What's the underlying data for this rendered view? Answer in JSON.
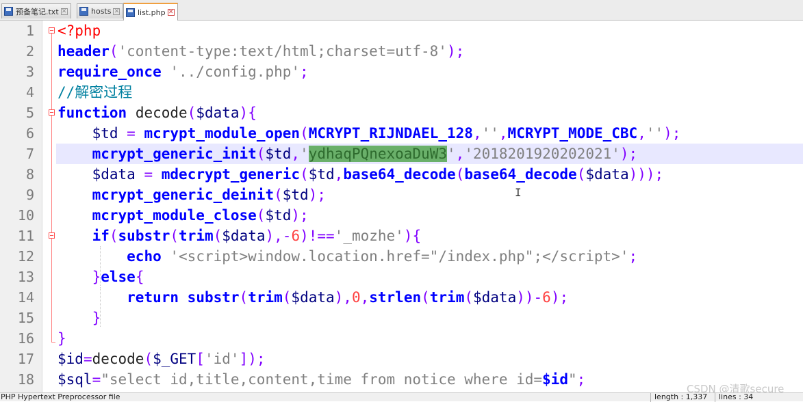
{
  "tabs": [
    {
      "label": "预备笔记.txt",
      "active": false
    },
    {
      "label": "hosts",
      "active": false
    },
    {
      "label": "list.php",
      "active": true
    }
  ],
  "editor": {
    "current_line": 7,
    "lines": [
      {
        "n": "1",
        "html": "<span class=\"tag\">&lt;?php</span>"
      },
      {
        "n": "2",
        "html": "<span class=\"kw\">header</span><span class=\"op\">(</span><span class=\"str\">'content-type:text/html;charset=utf-8'</span><span class=\"op\">);</span>"
      },
      {
        "n": "3",
        "html": "<span class=\"kw\">require_once</span> <span class=\"str\">'../config.php'</span><span class=\"op\">;</span>"
      },
      {
        "n": "4",
        "html": "<span class=\"cmt\">//解密过程</span>"
      },
      {
        "n": "5",
        "html": "<span class=\"kw\">function</span> <span class=\"plain\">decode</span><span class=\"op\">(</span><span class=\"var\">$data</span><span class=\"op\">){</span>"
      },
      {
        "n": "6",
        "html": "    <span class=\"var\">$td</span> <span class=\"op\">=</span> <span class=\"kw\">mcrypt_module_open</span><span class=\"op\">(</span><span class=\"kw\">MCRYPT_RIJNDAEL_128</span><span class=\"op\">,</span><span class=\"str\">''</span><span class=\"op\">,</span><span class=\"kw\">MCRYPT_MODE_CBC</span><span class=\"op\">,</span><span class=\"str\">''</span><span class=\"op\">);</span>"
      },
      {
        "n": "7",
        "html": "    <span class=\"kw\">mcrypt_generic_init</span><span class=\"op\">(</span><span class=\"var\">$td</span><span class=\"op\">,</span><span class=\"str\">'</span><span class=\"hl\">ydhaqPQnexoaDuW3</span><span class=\"str\">'</span><span class=\"op\">,</span><span class=\"str\">'2018201920202021'</span><span class=\"op\">);</span>"
      },
      {
        "n": "8",
        "html": "    <span class=\"var\">$data</span> <span class=\"op\">=</span> <span class=\"kw\">mdecrypt_generic</span><span class=\"op\">(</span><span class=\"var\">$td</span><span class=\"op\">,</span><span class=\"kw\">base64_decode</span><span class=\"op\">(</span><span class=\"kw\">base64_decode</span><span class=\"op\">(</span><span class=\"var\">$data</span><span class=\"op\">)));</span>"
      },
      {
        "n": "9",
        "html": "    <span class=\"kw\">mcrypt_generic_deinit</span><span class=\"op\">(</span><span class=\"var\">$td</span><span class=\"op\">);</span>"
      },
      {
        "n": "10",
        "html": "    <span class=\"kw\">mcrypt_module_close</span><span class=\"op\">(</span><span class=\"var\">$td</span><span class=\"op\">);</span>"
      },
      {
        "n": "11",
        "html": "    <span class=\"kw\">if</span><span class=\"op\">(</span><span class=\"kw\">substr</span><span class=\"op\">(</span><span class=\"kw\">trim</span><span class=\"op\">(</span><span class=\"var\">$data</span><span class=\"op\">),-</span><span class=\"num\">6</span><span class=\"op\">)!==</span><span class=\"str\">'_mozhe'</span><span class=\"op\">){</span>"
      },
      {
        "n": "12",
        "html": "        <span class=\"kw\">echo</span> <span class=\"str\">'&lt;script&gt;window.location.href=\"/index.php\";&lt;/script&gt;'</span><span class=\"op\">;</span>"
      },
      {
        "n": "13",
        "html": "    <span class=\"op\">}</span><span class=\"kw\">else</span><span class=\"op\">{</span>"
      },
      {
        "n": "14",
        "html": "        <span class=\"kw\">return</span> <span class=\"kw\">substr</span><span class=\"op\">(</span><span class=\"kw\">trim</span><span class=\"op\">(</span><span class=\"var\">$data</span><span class=\"op\">),</span><span class=\"num\">0</span><span class=\"op\">,</span><span class=\"kw\">strlen</span><span class=\"op\">(</span><span class=\"kw\">trim</span><span class=\"op\">(</span><span class=\"var\">$data</span><span class=\"op\">))-</span><span class=\"num\">6</span><span class=\"op\">);</span>"
      },
      {
        "n": "15",
        "html": "    <span class=\"op\">}</span>"
      },
      {
        "n": "16",
        "html": "<span class=\"op\">}</span>"
      },
      {
        "n": "17",
        "html": "<span class=\"var\">$id</span><span class=\"op\">=</span><span class=\"plain\">decode</span><span class=\"op\">(</span><span class=\"var\">$_GET</span><span class=\"op\">[</span><span class=\"str\">'id'</span><span class=\"op\">]);</span>"
      },
      {
        "n": "18",
        "html": "<span class=\"var\">$sql</span><span class=\"op\">=</span><span class=\"str\">\"select id,title,content,time from notice where id=</span><span class=\"kw\">$id</span><span class=\"str\">\"</span><span class=\"op\">;</span>"
      }
    ]
  },
  "statusbar": {
    "file_type": "PHP Hypertext Preprocessor file",
    "length": "length : 1,337",
    "lines": "lines : 34"
  },
  "watermark": "CSDN @清歌secure"
}
